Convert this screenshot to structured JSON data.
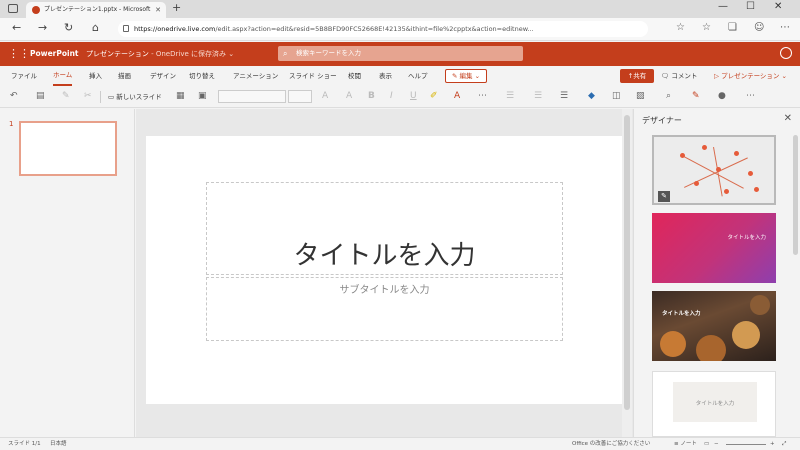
{
  "browser": {
    "tab_title": "プレゼンテーション1.pptx - Microsoft",
    "new_tab_symbol": "+",
    "url_host": "https://onedrive.live.com",
    "url_rest": "/edit.aspx?action=edit&resid=5B8BFD90FC52668E!42135&ithint=file%2cpptx&action=editnew..."
  },
  "office_header": {
    "app_name": "PowerPoint",
    "doc_name": "プレゼンテーション",
    "save_status": "- OneDrive に保存済み ⌄",
    "search_placeholder": "検索キーワードを入力"
  },
  "ribbon": {
    "tabs": [
      "ファイル",
      "ホーム",
      "挿入",
      "描画",
      "デザイン",
      "切り替え",
      "アニメーション",
      "スライド ショー",
      "校閲",
      "表示",
      "ヘルプ"
    ],
    "active_tab": "ホーム",
    "edit_label": "✎ 編集 ⌄",
    "share_label": "↑共有",
    "comment_label": "🗨 コメント",
    "present_label": "▷ プレゼンテーション ⌄",
    "new_slide_label": "新しいスライド"
  },
  "slides": {
    "thumbnail_number": "1"
  },
  "slide": {
    "title_placeholder": "タイトルを入力",
    "subtitle_placeholder": "サブタイトルを入力"
  },
  "designer": {
    "title": "デザイナー",
    "card2_text": "タイトルを入力",
    "card3_text": "タイトルを入力",
    "card4_text": "タイトルを入力"
  },
  "status_bar": {
    "slide_counter": "スライド 1/1",
    "language": "日本語",
    "feedback": "Office の改善にご協力ください",
    "notes": "≡ ノート",
    "zoom_plus": "+",
    "zoom_minus": "−"
  },
  "colors": {
    "brand": "#c43e1c",
    "card2_start": "#e0265a",
    "card2_end": "#8e3fae"
  }
}
